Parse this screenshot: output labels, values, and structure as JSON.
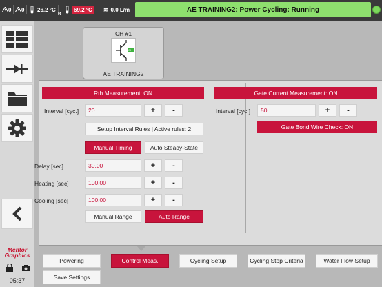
{
  "topbar": {
    "alarm_count": "0",
    "warning_count": "0",
    "ambient_temp": "26.2 °C",
    "r_label": "R",
    "coolant_temp": "69.2 °C",
    "flow": "0.0 L/m",
    "status": "AE TRAINING2: Power Cycling: Running"
  },
  "sidebar": {
    "logo_line1": "Mentor",
    "logo_line2": "Graphics",
    "time": "05:37"
  },
  "channel": {
    "label": "CH #1",
    "name": "AE TRAINING2",
    "badge": "CH"
  },
  "rth": {
    "header": "Rth Measurement: ON",
    "interval_label": "Interval [cyc.]",
    "interval_value": "20",
    "plus": "+",
    "minus": "-",
    "setup_rules": "Setup Interval Rules | Active rules: 2",
    "manual_timing": "Manual Timing",
    "auto_steady": "Auto Steady-State",
    "delay_label": "Delay [sec]",
    "delay_value": "30.00",
    "heating_label": "Heating [sec]",
    "heating_value": "100.00",
    "cooling_label": "Cooling [sec]",
    "cooling_value": "100.00",
    "manual_range": "Manual Range",
    "auto_range": "Auto Range"
  },
  "gate": {
    "header": "Gate Current Measurement: ON",
    "interval_label": "Interval [cyc.]",
    "interval_value": "50",
    "plus": "+",
    "minus": "-",
    "bond_check": "Gate Bond Wire Check: ON"
  },
  "tabs": {
    "powering": "Powering",
    "control": "Control Meas.",
    "cycling_setup": "Cycling Setup",
    "stop_criteria": "Cycling Stop Criteria",
    "water_flow": "Water Flow Setup",
    "save": "Save Settings"
  },
  "colors": {
    "accent": "#c8143c",
    "status_ok": "#8ee06e"
  }
}
